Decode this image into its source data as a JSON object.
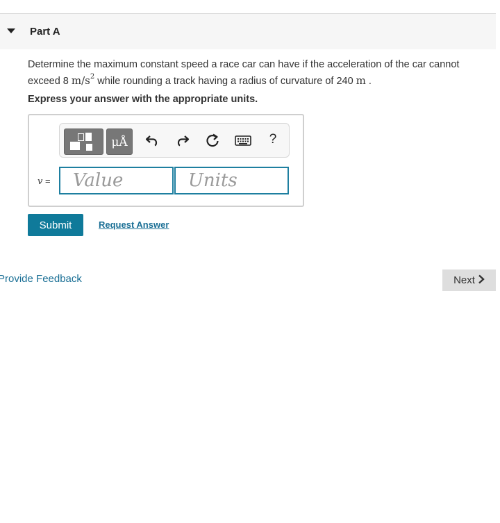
{
  "part": {
    "title": "Part A"
  },
  "question": {
    "text_1": "Determine the maximum constant speed a race car can have if the acceleration of the car cannot exceed 8 ",
    "unit_accel": "m/s",
    "unit_accel_exp": "2",
    "text_2": " while rounding a track having a radius of curvature of 240 ",
    "unit_radius": "m",
    "text_3": " .",
    "instruction": "Express your answer with the appropriate units."
  },
  "toolbar": {
    "units_label": "μÅ",
    "help_label": "?",
    "icons": [
      "templates-icon",
      "units-icon",
      "undo-icon",
      "redo-icon",
      "reset-icon",
      "keyboard-icon",
      "help-icon"
    ]
  },
  "answer": {
    "variable": "v",
    "equals": " =",
    "value_placeholder": "Value",
    "units_placeholder": "Units",
    "value": "",
    "units": ""
  },
  "actions": {
    "submit_label": "Submit",
    "request_label": "Request Answer",
    "feedback_label": "Provide Feedback",
    "next_label": "Next"
  },
  "colors": {
    "accent": "#0f7a9a",
    "link": "#1a6f95",
    "input_border": "#1e7fa0",
    "toolbar_button": "#777777",
    "next_button": "#dedede"
  }
}
